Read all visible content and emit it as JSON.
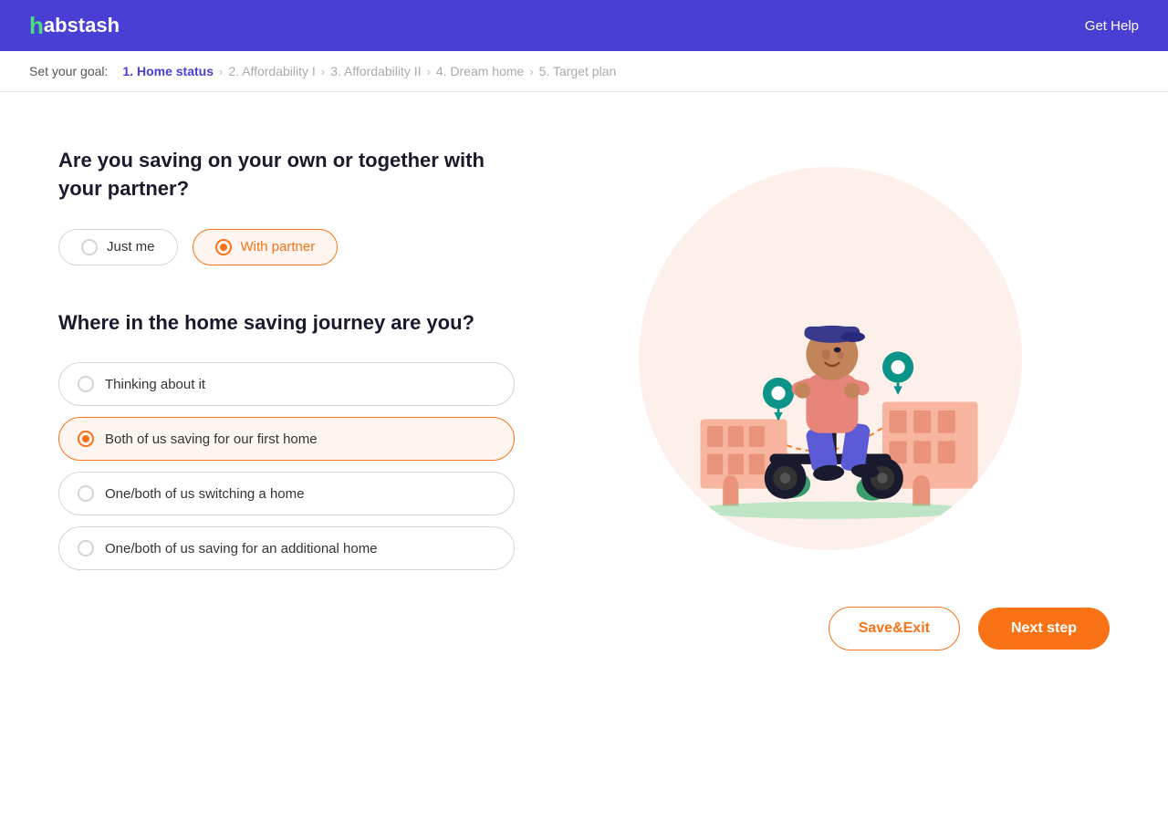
{
  "header": {
    "logo_h": "h",
    "logo_rest": "abstash",
    "get_help": "Get Help"
  },
  "breadcrumb": {
    "label": "Set your goal:",
    "steps": [
      {
        "id": "step1",
        "label": "1. Home status",
        "active": true
      },
      {
        "id": "step2",
        "label": "2. Affordability I",
        "active": false
      },
      {
        "id": "step3",
        "label": "3. Affordability II",
        "active": false
      },
      {
        "id": "step4",
        "label": "4. Dream home",
        "active": false
      },
      {
        "id": "step5",
        "label": "5. Target plan",
        "active": false
      }
    ]
  },
  "section1": {
    "question": "Are you saving on your own or together with your partner?",
    "options": [
      {
        "id": "just-me",
        "label": "Just me",
        "selected": false
      },
      {
        "id": "with-partner",
        "label": "With partner",
        "selected": true
      }
    ]
  },
  "section2": {
    "question": "Where in the home saving journey are you?",
    "options": [
      {
        "id": "thinking",
        "label": "Thinking about it",
        "selected": false
      },
      {
        "id": "both-saving",
        "label": "Both of us saving for our first home",
        "selected": true
      },
      {
        "id": "switching",
        "label": "One/both of us switching a home",
        "selected": false
      },
      {
        "id": "additional",
        "label": "One/both of us saving for an additional home",
        "selected": false
      }
    ]
  },
  "footer": {
    "save_exit": "Save&Exit",
    "next_step": "Next step"
  },
  "colors": {
    "accent": "#f97316",
    "brand": "#4a3fd4",
    "green": "#4ade80"
  }
}
